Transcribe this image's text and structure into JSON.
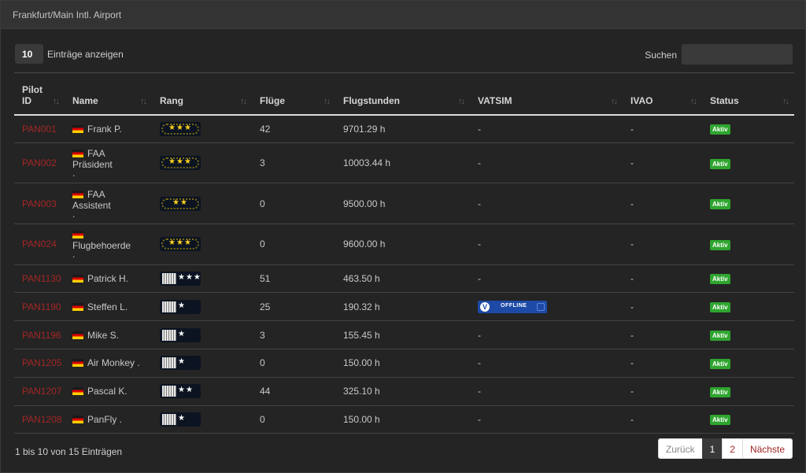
{
  "panel": {
    "title": "Frankfurt/Main Intl. Airport"
  },
  "controls": {
    "page_length": "10",
    "page_length_label": "Einträge anzeigen",
    "search_label": "Suchen",
    "search_value": ""
  },
  "columns": [
    {
      "line1": "Pilot",
      "line2": "ID"
    },
    {
      "line1": "",
      "line2": "Name"
    },
    {
      "line1": "",
      "line2": "Rang"
    },
    {
      "line1": "",
      "line2": "Flüge"
    },
    {
      "line1": "",
      "line2": "Flugstunden"
    },
    {
      "line1": "",
      "line2": "VATSIM"
    },
    {
      "line1": "",
      "line2": "IVAO"
    },
    {
      "line1": "",
      "line2": "Status"
    }
  ],
  "sort_icon": "sort-updown-icon",
  "rows": [
    {
      "id": "PAN001",
      "name": "Frank P.",
      "name_sub": "",
      "rank_type": "wreath",
      "rank_stars": "★★★",
      "flights": "42",
      "hours": "9701.29 h",
      "vatsim": "-",
      "ivao": "-",
      "status": "Aktiv"
    },
    {
      "id": "PAN002",
      "name": "FAA Präsident",
      "name_sub": ".",
      "rank_type": "wreath",
      "rank_stars": "★★★",
      "flights": "3",
      "hours": "10003.44 h",
      "vatsim": "-",
      "ivao": "-",
      "status": "Aktiv"
    },
    {
      "id": "PAN003",
      "name": "FAA Assistent",
      "name_sub": ".",
      "rank_type": "wreath",
      "rank_stars": "★★",
      "flights": "0",
      "hours": "9500.00 h",
      "vatsim": "-",
      "ivao": "-",
      "status": "Aktiv"
    },
    {
      "id": "PAN024",
      "name": "Flugbehoerde",
      "name_sub": ".",
      "rank_type": "wreath",
      "rank_stars": "★★★",
      "flights": "0",
      "hours": "9600.00 h",
      "vatsim": "-",
      "ivao": "-",
      "status": "Aktiv"
    },
    {
      "id": "PAN1130",
      "name": "Patrick H.",
      "name_sub": "",
      "rank_type": "bars",
      "rank_stars": "★★★",
      "flights": "51",
      "hours": "463.50 h",
      "vatsim": "-",
      "ivao": "-",
      "status": "Aktiv"
    },
    {
      "id": "PAN1190",
      "name": "Steffen L.",
      "name_sub": "",
      "rank_type": "bars",
      "rank_stars": "★",
      "flights": "25",
      "hours": "190.32 h",
      "vatsim": "OFFLINE",
      "ivao": "-",
      "status": "Aktiv"
    },
    {
      "id": "PAN1196",
      "name": "Mike S.",
      "name_sub": "",
      "rank_type": "bars",
      "rank_stars": "★",
      "flights": "3",
      "hours": "155.45 h",
      "vatsim": "-",
      "ivao": "-",
      "status": "Aktiv"
    },
    {
      "id": "PAN1205",
      "name": "Air Monkey .",
      "name_sub": "",
      "rank_type": "bars",
      "rank_stars": "★",
      "flights": "0",
      "hours": "150.00 h",
      "vatsim": "-",
      "ivao": "-",
      "status": "Aktiv"
    },
    {
      "id": "PAN1207",
      "name": "Pascal K.",
      "name_sub": "",
      "rank_type": "bars",
      "rank_stars": "★★",
      "flights": "44",
      "hours": "325.10 h",
      "vatsim": "-",
      "ivao": "-",
      "status": "Aktiv"
    },
    {
      "id": "PAN1208",
      "name": "PanFly .",
      "name_sub": "",
      "rank_type": "bars",
      "rank_stars": "★",
      "flights": "0",
      "hours": "150.00 h",
      "vatsim": "-",
      "ivao": "-",
      "status": "Aktiv"
    }
  ],
  "footer": {
    "info": "1 bis 10 von 15 Einträgen",
    "prev_label": "Zurück",
    "pages": [
      "1",
      "2"
    ],
    "current_page": "1",
    "next_label": "Nächste"
  },
  "colors": {
    "pilot_id": "#a32626",
    "status_active": "#2fa52f",
    "vatsim_badge": "#1d4aa6"
  }
}
